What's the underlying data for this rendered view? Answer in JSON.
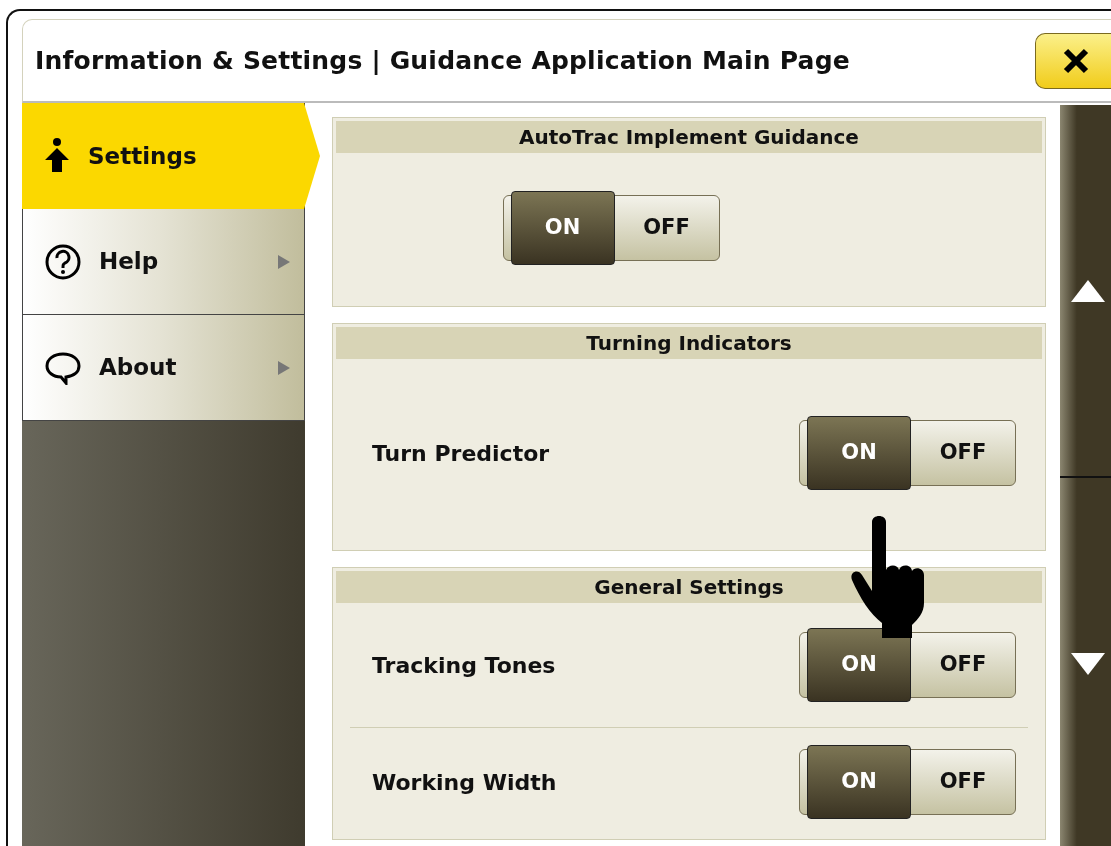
{
  "window": {
    "title": "Information & Settings | Guidance Application Main Page"
  },
  "sidebar": {
    "items": [
      {
        "label": "Settings",
        "selected": true,
        "has_submenu": false
      },
      {
        "label": "Help",
        "selected": false,
        "has_submenu": true
      },
      {
        "label": "About",
        "selected": false,
        "has_submenu": true
      }
    ]
  },
  "sections": [
    {
      "title": "AutoTrac Implement Guidance",
      "rows": [
        {
          "on": true,
          "on_label": "ON",
          "off_label": "OFF"
        }
      ]
    },
    {
      "title": "Turning Indicators",
      "rows": [
        {
          "label": "Turn Predictor",
          "on": true,
          "on_label": "ON",
          "off_label": "OFF"
        }
      ]
    },
    {
      "title": "General Settings",
      "rows": [
        {
          "label": "Tracking Tones",
          "on": true,
          "on_label": "ON",
          "off_label": "OFF"
        },
        {
          "label": "Working Width",
          "on": true,
          "on_label": "ON",
          "off_label": "OFF"
        }
      ]
    }
  ]
}
